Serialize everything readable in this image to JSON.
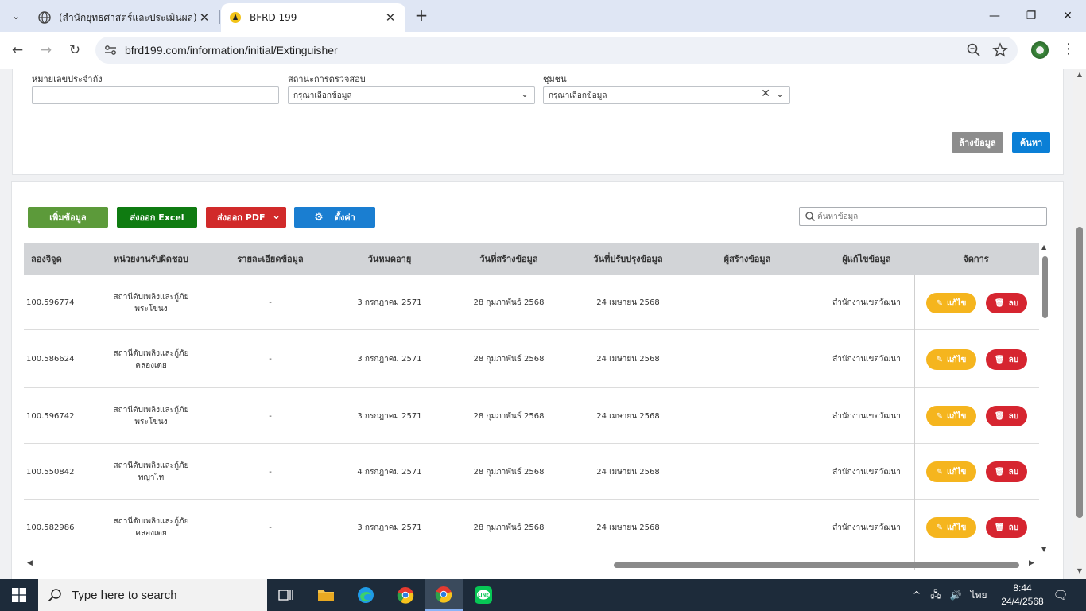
{
  "browser": {
    "tabs": [
      {
        "title": "(สำนักยุทธศาสตร์และประเมินผล) :: โ",
        "active": false
      },
      {
        "title": "BFRD 199",
        "active": true
      }
    ],
    "url": "bfrd199.com/information/initial/Extinguisher"
  },
  "filters": {
    "tank_no_label": "หมายเลขประจำถัง",
    "tank_no_value": "",
    "status_label": "สถานะการตรวจสอบ",
    "status_value": "กรุณาเลือกข้อมูล",
    "community_label": "ชุมชน",
    "community_value": "กรุณาเลือกข้อมูล",
    "clear_label": "ล้างข้อมูล",
    "search_label": "ค้นหา"
  },
  "toolbar": {
    "add_label": "เพิ่มข้อมูล",
    "excel_label": "ส่งออก Excel",
    "pdf_label": "ส่งออก PDF",
    "settings_label": "ตั้งค่า",
    "search_placeholder": "ค้นหาข้อมูล"
  },
  "table": {
    "headers": [
      "ลองจิจูด",
      "หน่วยงานรับผิดชอบ",
      "รายละเอียดข้อมูล",
      "วันหมดอายุ",
      "วันที่สร้างข้อมูล",
      "วันที่ปรับปรุงข้อมูล",
      "ผู้สร้างข้อมูล",
      "ผู้แก้ไขข้อมูล",
      "จัดการ"
    ],
    "edit_label": "แก้ไข",
    "delete_label": "ลบ",
    "rows": [
      {
        "lng": "100.596774",
        "unit1": "สถานีดับเพลิงและกู้ภัย",
        "unit2": "พระโขนง",
        "detail": "-",
        "expire": "3 กรกฎาคม 2571",
        "created": "28 กุมภาพันธ์ 2568",
        "updated": "24 เมษายน 2568",
        "creator": "",
        "editor": "สำนักงานเขตวัฒนา"
      },
      {
        "lng": "100.586624",
        "unit1": "สถานีดับเพลิงและกู้ภัย",
        "unit2": "คลองเตย",
        "detail": "-",
        "expire": "3 กรกฎาคม 2571",
        "created": "28 กุมภาพันธ์ 2568",
        "updated": "24 เมษายน 2568",
        "creator": "",
        "editor": "สำนักงานเขตวัฒนา"
      },
      {
        "lng": "100.596742",
        "unit1": "สถานีดับเพลิงและกู้ภัย",
        "unit2": "พระโขนง",
        "detail": "-",
        "expire": "3 กรกฎาคม 2571",
        "created": "28 กุมภาพันธ์ 2568",
        "updated": "24 เมษายน 2568",
        "creator": "",
        "editor": "สำนักงานเขตวัฒนา"
      },
      {
        "lng": "100.550842",
        "unit1": "สถานีดับเพลิงและกู้ภัย",
        "unit2": "พญาไท",
        "detail": "-",
        "expire": "4 กรกฎาคม 2571",
        "created": "28 กุมภาพันธ์ 2568",
        "updated": "24 เมษายน 2568",
        "creator": "",
        "editor": "สำนักงานเขตวัฒนา"
      },
      {
        "lng": "100.582986",
        "unit1": "สถานีดับเพลิงและกู้ภัย",
        "unit2": "คลองเตย",
        "detail": "-",
        "expire": "3 กรกฎาคม 2571",
        "created": "28 กุมภาพันธ์ 2568",
        "updated": "24 เมษายน 2568",
        "creator": "",
        "editor": "สำนักงานเขตวัฒนา"
      }
    ]
  },
  "taskbar": {
    "search_placeholder": "Type here to search",
    "language": "ไทย",
    "time": "8:44",
    "date": "24/4/2568"
  },
  "colors": {
    "add": "#5c9a3a",
    "excel": "#0f7b11",
    "pdf": "#d12a2a",
    "settings": "#1a7ed1",
    "search": "#0a7fd6",
    "clear": "#8d8d8d",
    "edit": "#f5b51e",
    "delete": "#d62530"
  }
}
